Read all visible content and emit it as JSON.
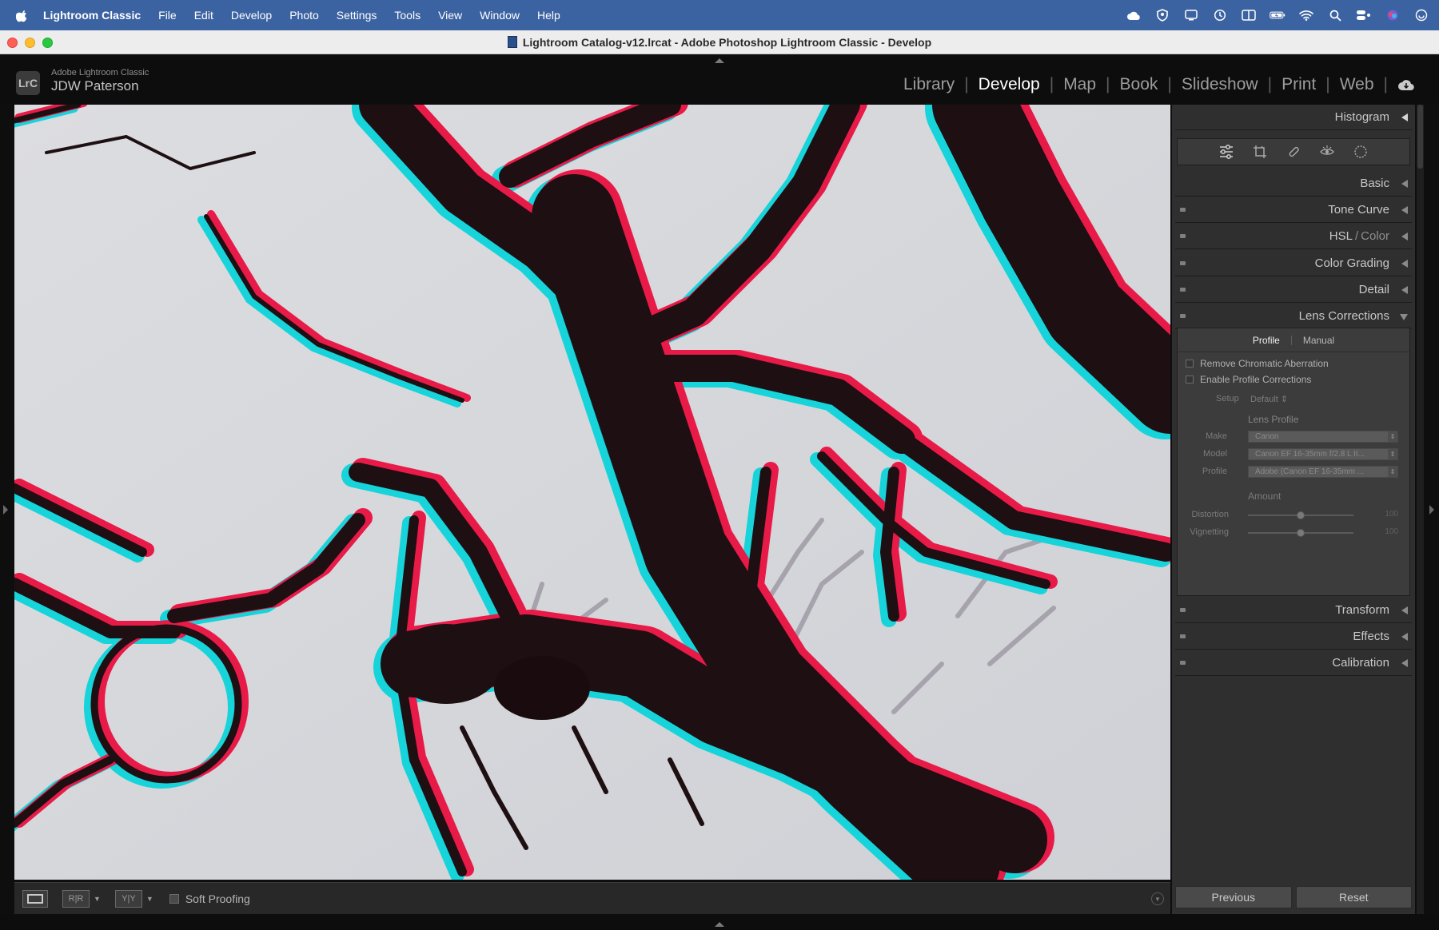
{
  "menubar": {
    "app_name": "Lightroom Classic",
    "items": [
      "File",
      "Edit",
      "Develop",
      "Photo",
      "Settings",
      "Tools",
      "View",
      "Window",
      "Help"
    ]
  },
  "window": {
    "title": "Lightroom Catalog-v12.lrcat - Adobe Photoshop Lightroom Classic - Develop"
  },
  "identity": {
    "badge": "LrC",
    "product": "Adobe Lightroom Classic",
    "user": "JDW Paterson"
  },
  "modules": [
    "Library",
    "Develop",
    "Map",
    "Book",
    "Slideshow",
    "Print",
    "Web"
  ],
  "active_module": "Develop",
  "panel": {
    "histogram": "Histogram",
    "basic": "Basic",
    "tone_curve": "Tone Curve",
    "hsl": "HSL",
    "hsl_slash": "/",
    "hsl_color": "Color",
    "color_grading": "Color Grading",
    "detail": "Detail",
    "lens_corrections": "Lens Corrections",
    "transform": "Transform",
    "effects": "Effects",
    "calibration": "Calibration"
  },
  "lens": {
    "tab_profile": "Profile",
    "tab_manual": "Manual",
    "remove_ca": "Remove Chromatic Aberration",
    "enable_profile": "Enable Profile Corrections",
    "setup_label": "Setup",
    "setup_value": "Default",
    "lens_profile_title": "Lens Profile",
    "make_label": "Make",
    "make_value": "Canon",
    "model_label": "Model",
    "model_value": "Canon EF 16-35mm f/2.8 L II...",
    "profile_label": "Profile",
    "profile_value": "Adobe (Canon EF 16-35mm ...",
    "amount_title": "Amount",
    "distortion_label": "Distortion",
    "distortion_value": "100",
    "vignetting_label": "Vignetting",
    "vignetting_value": "100"
  },
  "toolbar": {
    "rr": "R|R",
    "yy": "Y|Y",
    "soft_proofing": "Soft Proofing"
  },
  "buttons": {
    "previous": "Previous",
    "reset": "Reset"
  },
  "colors": {
    "menubar": "#3c63a1",
    "panel": "#2f2f2f",
    "sky": "#d7d9dd",
    "fringe_red": "#e81c45",
    "fringe_cyan": "#18d2d8"
  }
}
